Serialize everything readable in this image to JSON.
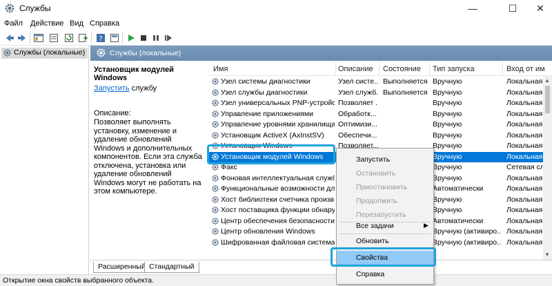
{
  "window": {
    "title": "Службы"
  },
  "menu": [
    "Файл",
    "Действие",
    "Вид",
    "Справка"
  ],
  "tree": {
    "item": "Службы (локальные)"
  },
  "header": {
    "title": "Службы (локальные)"
  },
  "description_panel": {
    "service_name": "Установщик модулей Windows",
    "start_link": "Запустить",
    "start_suffix": " службу",
    "desc_label": "Описание:",
    "desc_text": "Позволяет выполнять установку, изменение и удаление обновлений Windows и дополнительных компонентов. Если эта служба отключена, установка или удаление обновлений Windows могут не работать на этом компьютере."
  },
  "columns": [
    "Имя",
    "Описание",
    "Состояние",
    "Тип запуска",
    "Вход от им"
  ],
  "services": [
    {
      "name": "Узел системы диагностики",
      "desc": "Узел систе...",
      "state": "Выполняется",
      "startup": "Вручную",
      "logon": "Локальная"
    },
    {
      "name": "Узел службы диагностики",
      "desc": "Узел служб...",
      "state": "Выполняется",
      "startup": "Вручную",
      "logon": "Локальная"
    },
    {
      "name": "Узел универсальных PNP-устройств",
      "desc": "Позволяет ...",
      "state": "",
      "startup": "Вручную",
      "logon": "Локальная"
    },
    {
      "name": "Управление приложениями",
      "desc": "Обработк...",
      "state": "",
      "startup": "Вручную",
      "logon": "Локальная"
    },
    {
      "name": "Управление уровнями хранилища",
      "desc": "Оптимизи...",
      "state": "",
      "startup": "Вручную",
      "logon": "Локальная"
    },
    {
      "name": "Установщик ActiveX (AxInstSV)",
      "desc": "Обеспечи...",
      "state": "",
      "startup": "Вручную",
      "logon": "Локальная"
    },
    {
      "name": "Установщик Windows",
      "desc": "Позволяет...",
      "state": "",
      "startup": "Вручную",
      "logon": "Локальная"
    },
    {
      "name": "Установщик модулей Windows",
      "desc": "",
      "state": "",
      "startup": "Вручную",
      "logon": "Локальная"
    },
    {
      "name": "Факс",
      "desc": "",
      "state": "",
      "startup": "Вручную",
      "logon": "Сетевая слу"
    },
    {
      "name": "Фоновая интеллектуальная служб...",
      "desc": "",
      "state": "",
      "startup": "Вручную",
      "logon": "Локальная"
    },
    {
      "name": "Функциональные возможности для...",
      "desc": "",
      "state": "",
      "startup": "Автоматически",
      "logon": "Локальная"
    },
    {
      "name": "Хост библиотеки счетчика произв...",
      "desc": "",
      "state": "",
      "startup": "Вручную",
      "logon": "Локальная"
    },
    {
      "name": "Хост поставщика функции обнару...",
      "desc": "",
      "state": "",
      "startup": "Вручную",
      "logon": "Локальная"
    },
    {
      "name": "Центр обеспечения безопасности",
      "desc": "",
      "state": "",
      "startup": "Автоматически",
      "logon": "Локальная"
    },
    {
      "name": "Центр обновления Windows",
      "desc": "",
      "state": "",
      "startup": "Вручную (активиро...",
      "logon": "Локальная"
    },
    {
      "name": "Шифрованная файловая система (...",
      "desc": "",
      "state": "",
      "startup": "Вручную (активиро...",
      "logon": "Локальная"
    }
  ],
  "context_menu": {
    "start": "Запустить",
    "stop": "Остановить",
    "pause": "Приостановить",
    "resume": "Продолжить",
    "restart": "Перезапустить",
    "all_tasks": "Все задачи",
    "refresh": "Обновить",
    "properties": "Свойства",
    "help": "Справка"
  },
  "tabs": [
    "Расширенный",
    "Стандартный"
  ],
  "status": "Открытие окна свойств выбранного объекта.",
  "colors": {
    "selection": "#0078d7",
    "highlight_box": "#1fa3dc",
    "menu_hover": "#91c9f7",
    "header": "#7a9bbd"
  }
}
